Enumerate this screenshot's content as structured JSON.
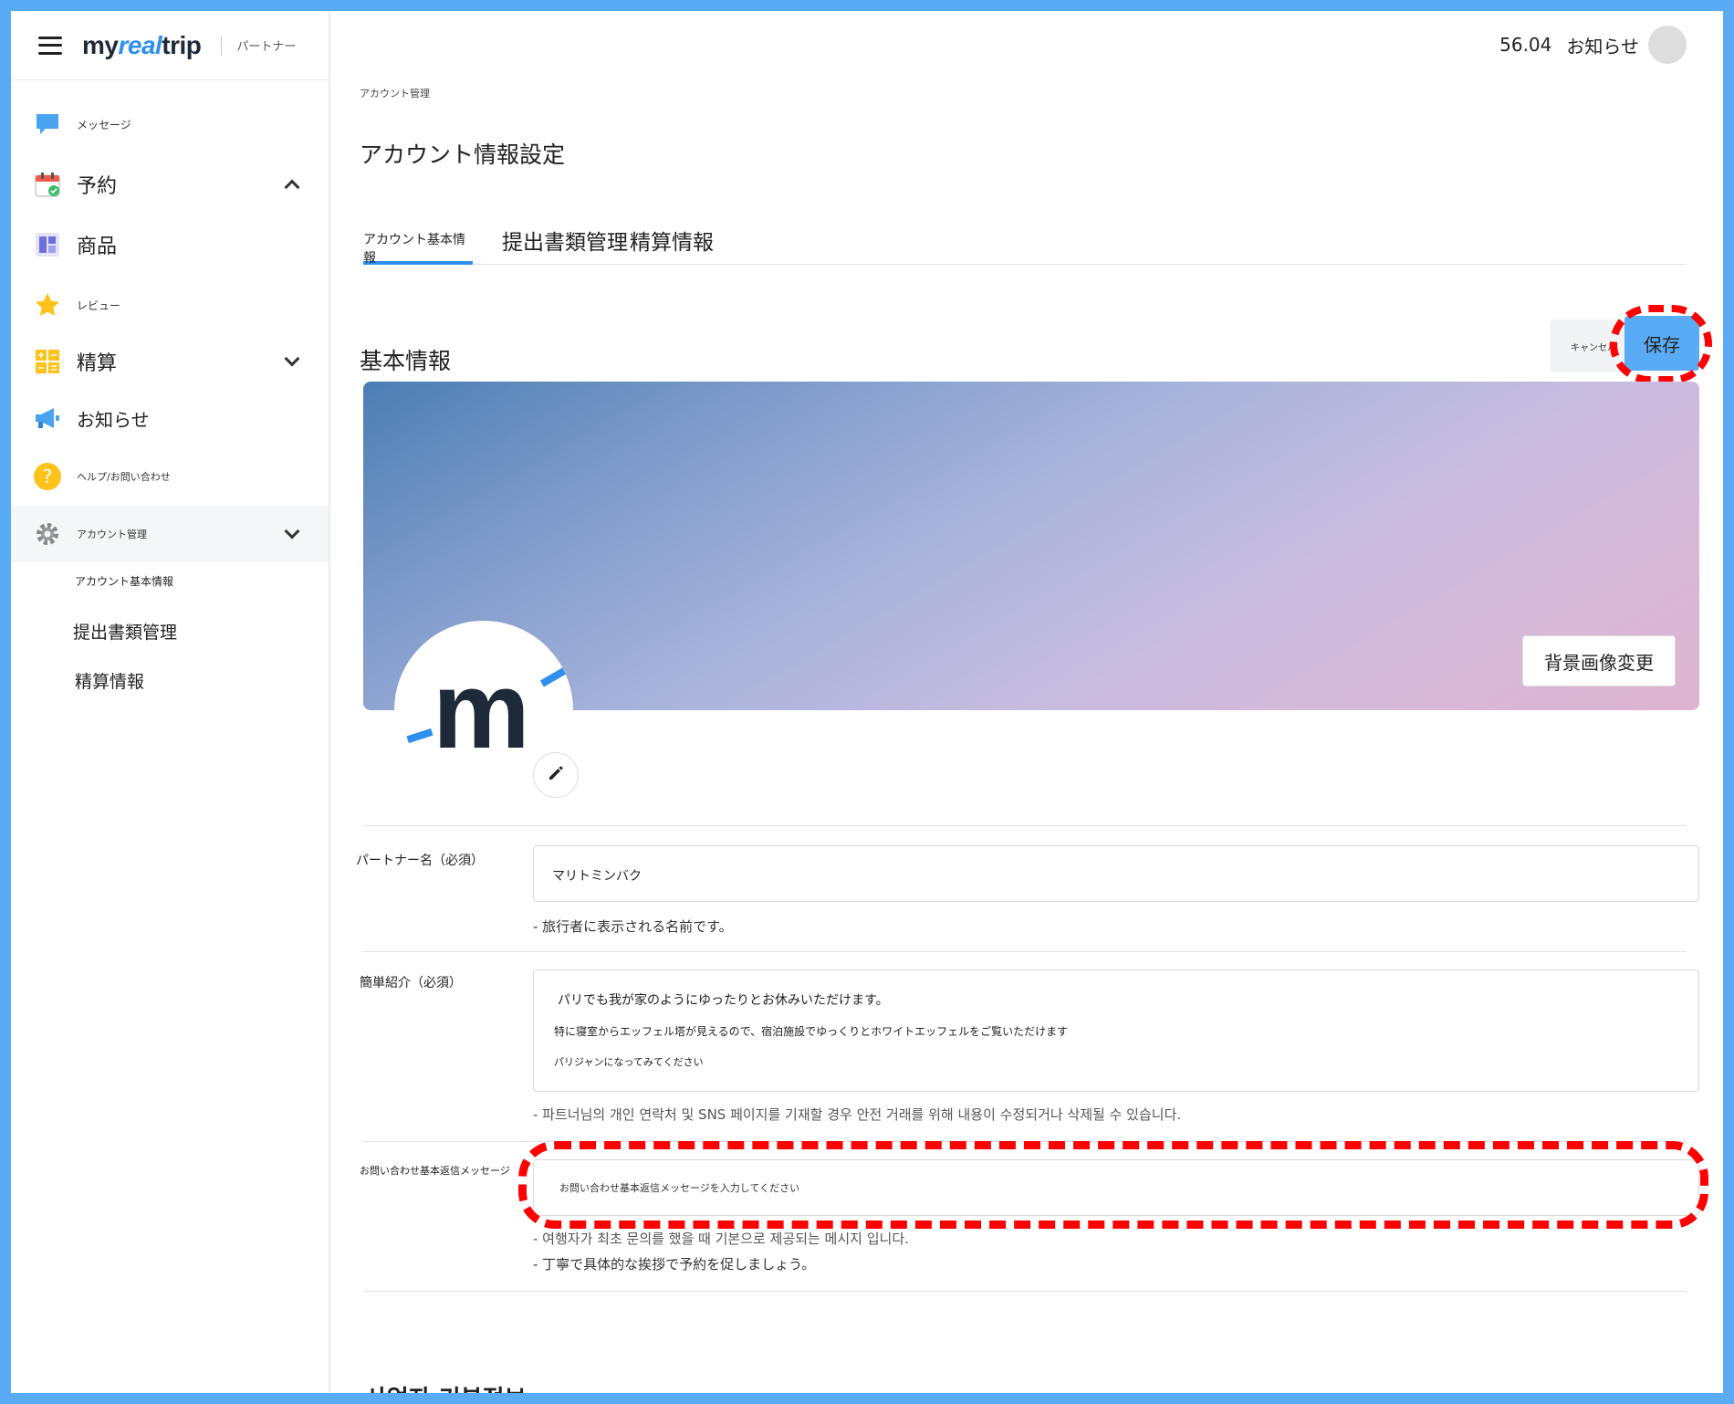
{
  "app": {
    "logo_pre": "my",
    "logo_accent": "real",
    "logo_post": "trip",
    "logo_sub": "パートナー"
  },
  "sidebar": {
    "items": [
      {
        "label": "メッセージ",
        "icon": "message-icon"
      },
      {
        "label": "予約",
        "icon": "calendar-icon"
      },
      {
        "label": "商品",
        "icon": "product-icon"
      },
      {
        "label": "レビュー",
        "icon": "star-icon"
      },
      {
        "label": "精算",
        "icon": "calculator-icon"
      },
      {
        "label": "お知らせ",
        "icon": "megaphone-icon"
      },
      {
        "label": "ヘルプ/お問い合わせ",
        "icon": "help-icon"
      },
      {
        "label": "アカウント管理",
        "icon": "gear-icon"
      }
    ],
    "sub_items": [
      {
        "label": "アカウント基本情報"
      },
      {
        "label": "提出書類管理"
      },
      {
        "label": "精算情報"
      }
    ]
  },
  "header": {
    "number": "56.04",
    "notice": "お知らせ"
  },
  "breadcrumb": "アカウント管理",
  "page_title": "アカウント情報設定",
  "tabs": [
    {
      "label": "アカウント基本情報",
      "active": true
    },
    {
      "label": "提出書類管理",
      "active": false
    },
    {
      "label": "精算情報",
      "active": false
    }
  ],
  "section": {
    "title": "基本情報",
    "cancel_label": "キャンセル",
    "save_label": "保存",
    "banner_button": "背景画像変更"
  },
  "fields": {
    "partner_name": {
      "label": "パートナー名（必須）",
      "value": "マリトミンバク",
      "help": "- 旅行者に表示される名前です。"
    },
    "intro": {
      "label": "簡単紹介（必須）",
      "lines": [
        "パリでも我が家のようにゆったりとお休みいただけます。",
        "特に寝室からエッフェル塔が見えるので、宿泊施設でゆっくりとホワイトエッフェルをご覧いただけます",
        "パリジャンになってみてください"
      ],
      "help": "- 파트너님의 개인 연락처 및 SNS 페이지를 기재할 경우 안전 거래를 위해 내용이 수정되거나 삭제될 수 있습니다."
    },
    "inquiry": {
      "label": "お問い合わせ基本返信メッセージ",
      "placeholder": "お問い合わせ基本返信メッセージを入力してください",
      "help1": "- 여행자가 최초 문의를 했을 때 기본으로 제공되는 메시지 입니다.",
      "help2": "- 丁寧で具体的な挨拶で予約を促しましょう。"
    }
  },
  "next_section_title": "사업자 기본정보",
  "colors": {
    "accent": "#2d8ff0",
    "save_button": "#5aabf5",
    "highlight": "#ff0000"
  }
}
